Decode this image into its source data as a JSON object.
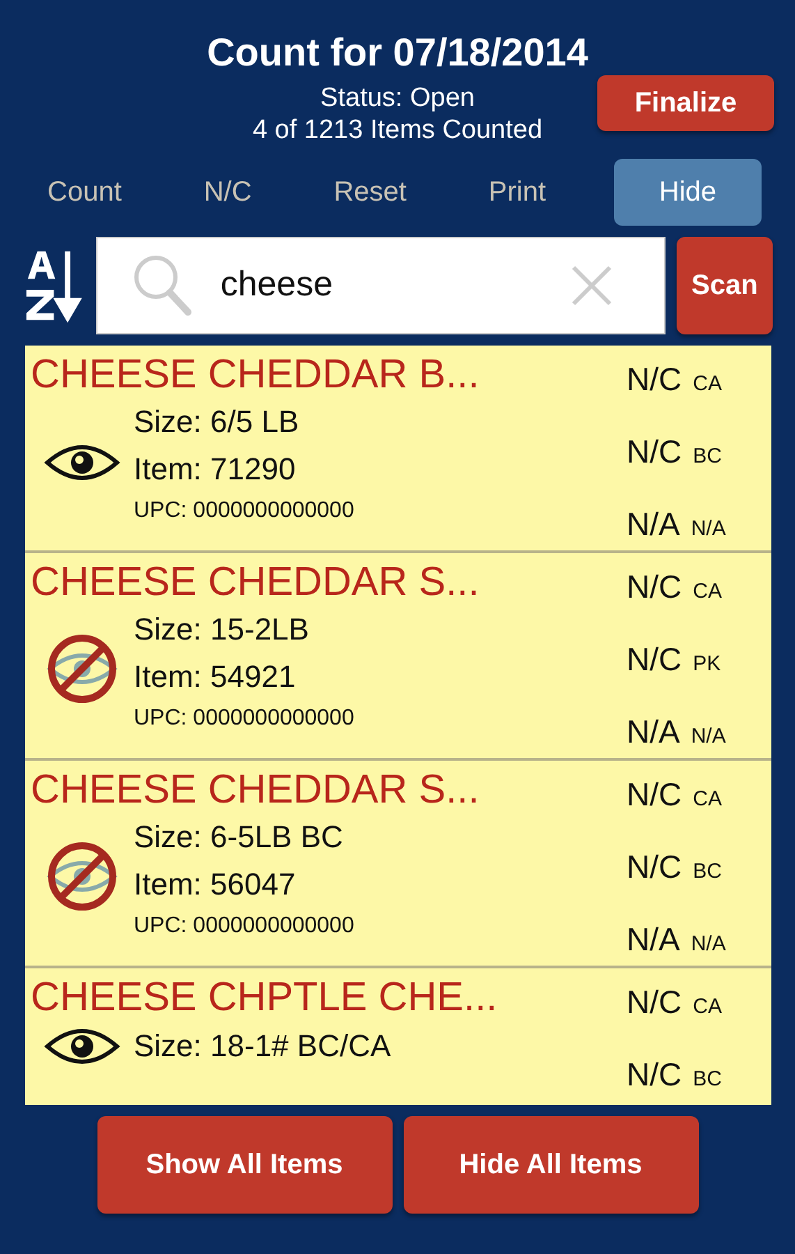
{
  "header": {
    "title": "Count for 07/18/2014",
    "status": "Status: Open",
    "progress": "4 of 1213 Items Counted",
    "finalize": "Finalize"
  },
  "tabs": [
    {
      "label": "Count",
      "selected": false
    },
    {
      "label": "N/C",
      "selected": false
    },
    {
      "label": "Reset",
      "selected": false
    },
    {
      "label": "Print",
      "selected": false
    },
    {
      "label": "Hide",
      "selected": true
    }
  ],
  "search": {
    "value": "cheese",
    "scan": "Scan"
  },
  "items": [
    {
      "name": "CHEESE CHEDDAR B...",
      "hidden": false,
      "size": "Size: 6/5 LB",
      "item": "Item: 71290",
      "upc": "UPC: 0000000000000",
      "counts": [
        {
          "value": "N/C",
          "unit": "CA"
        },
        {
          "value": "N/C",
          "unit": "BC"
        },
        {
          "value": "N/A",
          "unit": "N/A"
        }
      ]
    },
    {
      "name": "CHEESE CHEDDAR S...",
      "hidden": true,
      "size": "Size: 15-2LB",
      "item": "Item: 54921",
      "upc": "UPC: 0000000000000",
      "counts": [
        {
          "value": "N/C",
          "unit": "CA"
        },
        {
          "value": "N/C",
          "unit": "PK"
        },
        {
          "value": "N/A",
          "unit": "N/A"
        }
      ]
    },
    {
      "name": "CHEESE CHEDDAR S...",
      "hidden": true,
      "size": "Size: 6-5LB BC",
      "item": "Item: 56047",
      "upc": "UPC: 0000000000000",
      "counts": [
        {
          "value": "N/C",
          "unit": "CA"
        },
        {
          "value": "N/C",
          "unit": "BC"
        },
        {
          "value": "N/A",
          "unit": "N/A"
        }
      ]
    },
    {
      "name": "CHEESE CHPTLE CHE...",
      "hidden": false,
      "size": "Size: 18-1# BC/CA",
      "counts": [
        {
          "value": "N/C",
          "unit": "CA"
        },
        {
          "value": "N/C",
          "unit": "BC"
        }
      ]
    }
  ],
  "buttons": [
    "Show All Items",
    "Hide All Items"
  ]
}
